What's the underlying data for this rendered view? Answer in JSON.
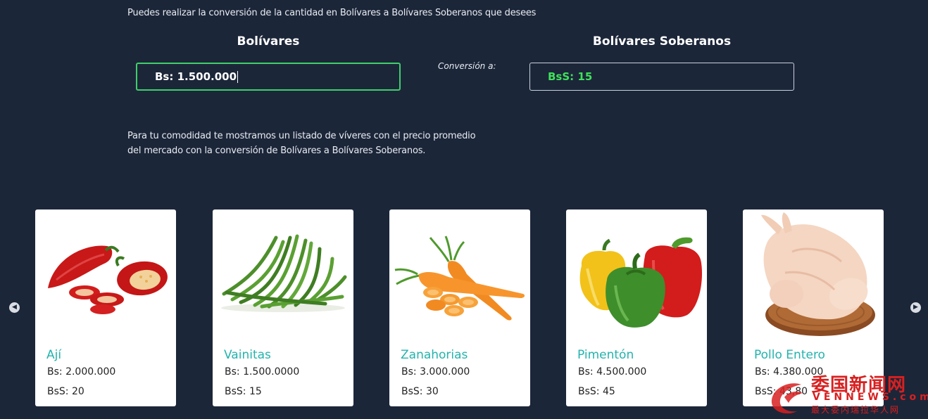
{
  "intro_text": "Puedes realizar la conversión de la cantidad en Bolívares a Bolívares Soberanos que desees",
  "converter": {
    "left_title": "Bolívares",
    "right_title": "Bolívares Soberanos",
    "input_value": "Bs: 1.500.000",
    "conversion_label": "Conversión a:",
    "output_value": "BsS: 15"
  },
  "note": {
    "line1": "Para tu comodidad te mostramos un listado de víveres con el precio promedio",
    "line2": "del mercado con la conversión de Bolívares a Bolívares Soberanos."
  },
  "carousel": {
    "prev_icon": "chevron-left-icon",
    "next_icon": "chevron-right-icon",
    "items": [
      {
        "name": "Ají",
        "bs": "Bs: 2.000.000",
        "bss": "BsS: 20",
        "image": "red-peppers"
      },
      {
        "name": "Vainitas",
        "bs": "Bs: 1.500.0000",
        "bss": "BsS: 15",
        "image": "green-beans"
      },
      {
        "name": "Zanahorias",
        "bs": "Bs: 3.000.000",
        "bss": "BsS: 30",
        "image": "carrots"
      },
      {
        "name": "Pimentón",
        "bs": "Bs: 4.500.000",
        "bss": "BsS: 45",
        "image": "bell-peppers"
      },
      {
        "name": "Pollo Entero",
        "bs": "Bs: 4.380.000",
        "bss": "BsS: 43,80",
        "image": "whole-chicken"
      }
    ]
  },
  "watermark": {
    "chinese": "委国新闻网",
    "english": "VENNEWS.com",
    "subtitle": "最大委内瑞拉华人网"
  },
  "colors": {
    "background": "#1c2639",
    "input_border_active": "#3ecf6a",
    "output_text": "#3ee15a",
    "product_name": "#23b3ad",
    "watermark": "#d82020"
  }
}
